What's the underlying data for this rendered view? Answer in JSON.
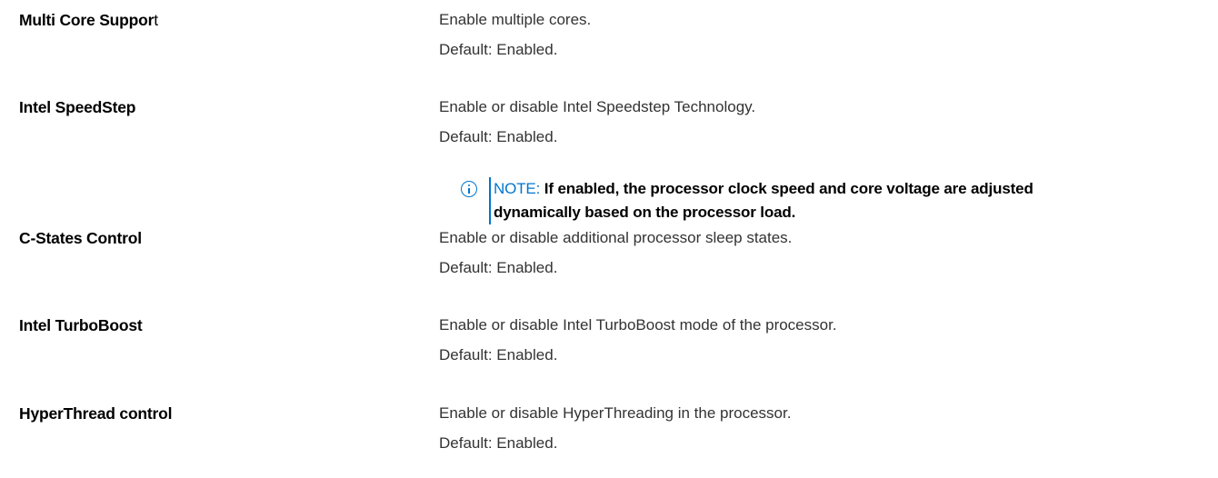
{
  "options": [
    {
      "name_bold": "Multi Core Suppor",
      "name_tail": "t",
      "description": "Enable multiple cores.",
      "default": "Default: Enabled."
    },
    {
      "name_bold": "Intel SpeedStep",
      "name_tail": "",
      "description": "Enable or disable Intel Speedstep Technology.",
      "default": "Default: Enabled."
    },
    {
      "name_bold": "C-States Control",
      "name_tail": "",
      "description": "Enable or disable additional processor sleep states.",
      "default": "Default: Enabled."
    },
    {
      "name_bold": "Intel TurboBoost",
      "name_tail": "",
      "description": "Enable or disable Intel TurboBoost mode of the processor.",
      "default": "Default: Enabled."
    },
    {
      "name_bold": "HyperThread control",
      "name_tail": "",
      "description": "Enable or disable HyperThreading in the processor.",
      "default": "Default: Enabled."
    }
  ],
  "note": {
    "icon": "info-icon",
    "label": "NOTE:",
    "line1": "If enabled, the processor clock speed and core voltage are adjusted",
    "line2": "dynamically based on the processor load.",
    "accent_color": "#0076ce"
  }
}
